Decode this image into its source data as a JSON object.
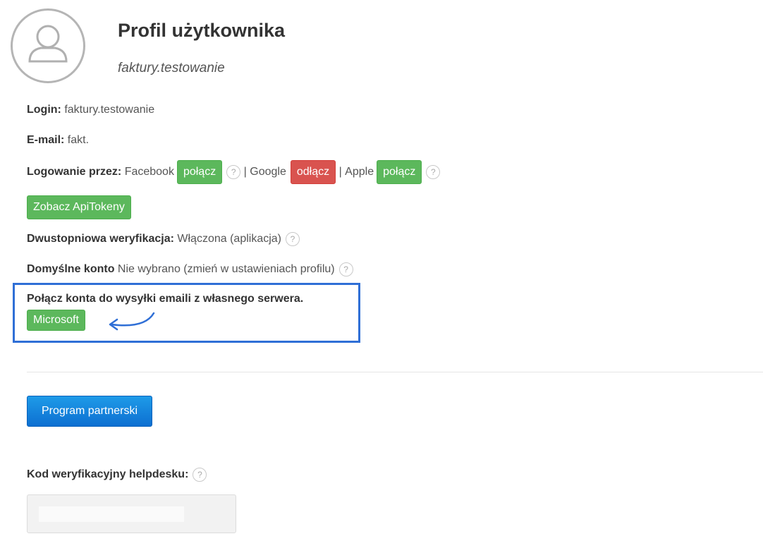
{
  "header": {
    "title": "Profil użytkownika",
    "username": "faktury.testowanie"
  },
  "profile": {
    "login_label": "Login:",
    "login_value": "faktury.testowanie",
    "email_label": "E-mail:",
    "email_value": "fakt.",
    "login_via_label": "Logowanie przez:",
    "facebook_label": "Facebook",
    "facebook_button": "połącz",
    "separator1": "|",
    "google_label": "Google",
    "google_button": "odłącz",
    "separator2": "|",
    "apple_label": "Apple",
    "apple_button": "połącz",
    "help_glyph": "?",
    "api_tokens_button": "Zobacz ApiTokeny",
    "twofa_label": "Dwustopniowa weryfikacja:",
    "twofa_value": "Włączona (aplikacja)",
    "default_account_label": "Domyślne konto",
    "default_account_value": "Nie wybrano (zmień w ustawieniach profilu)"
  },
  "email_server": {
    "heading": "Połącz konta do wysyłki emaili z własnego serwera.",
    "microsoft_button": "Microsoft"
  },
  "partner": {
    "button": "Program partnerski"
  },
  "helpdesk": {
    "label": "Kod weryfikacyjny helpdesku:",
    "code_value": ""
  },
  "colors": {
    "green": "#5cb85c",
    "red": "#d9534f",
    "blue": "#1a8ce0",
    "highlight": "#2f6fd6"
  },
  "icons": [
    "user-avatar-icon",
    "help-icon",
    "curved-arrow-icon"
  ]
}
